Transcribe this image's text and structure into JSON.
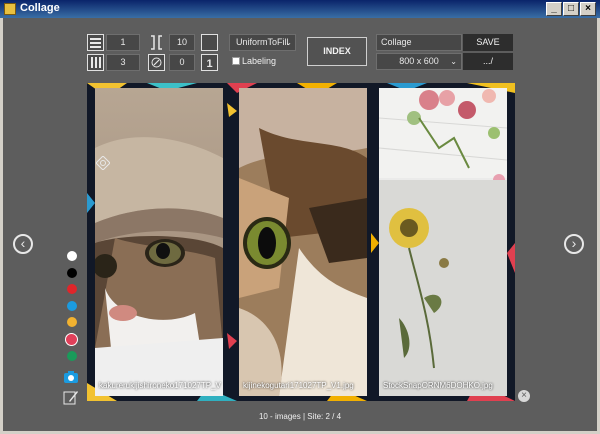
{
  "window": {
    "title": "Collage"
  },
  "toolbar": {
    "columns_value": "1",
    "rows_value": "3",
    "spacing_value": "10",
    "rotation_value": "0",
    "fit_mode": "UniformToFill",
    "labeling_label": "Labeling",
    "index_label": "INDEX",
    "title_value": "Collage",
    "save_label": "SAVE",
    "size_value": "800 x 600",
    "path_label": ".../"
  },
  "photos": [
    {
      "caption": "kakurerukijishironeko171027TP_V"
    },
    {
      "caption": "kijinekogutari171027TP_V1.jpg"
    },
    {
      "caption": "StockSnapORNM6DOHKO.jpg"
    }
  ],
  "palette": [
    "#ffffff",
    "#000000",
    "#e0252a",
    "#1b9be0",
    "#f2b230",
    "#e0405a",
    "#1a9a5a"
  ],
  "status": {
    "text": "10 - images | Site: 2 / 4"
  }
}
